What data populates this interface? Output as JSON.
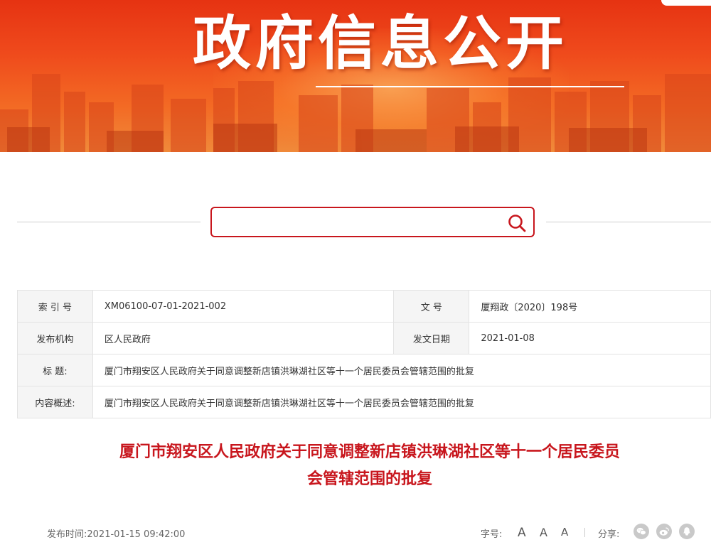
{
  "banner": {
    "title": "政府信息公开"
  },
  "search": {
    "placeholder": "",
    "value": ""
  },
  "info": {
    "index_label": "索 引 号",
    "index_value": "XM06100-07-01-2021-002",
    "doc_no_label": "文 号",
    "doc_no_value": "厦翔政〔2020〕198号",
    "issuer_label": "发布机构",
    "issuer_value": "区人民政府",
    "issue_date_label": "发文日期",
    "issue_date_value": "2021-01-08",
    "title_label": "标 题:",
    "title_value": "厦门市翔安区人民政府关于同意调整新店镇洪琳湖社区等十一个居民委员会管辖范围的批复",
    "summary_label": "内容概述:",
    "summary_value": "厦门市翔安区人民政府关于同意调整新店镇洪琳湖社区等十一个居民委员会管辖范围的批复"
  },
  "article": {
    "title_line1": "厦门市翔安区人民政府关于同意调整新店镇洪琳湖社区等十一个居民委员",
    "title_line2": "会管辖范围的批复"
  },
  "meta": {
    "publish_time": "发布时间:2021-01-15 09:42:00",
    "font_size_label": "字号:",
    "font_large": "A",
    "font_medium": "A",
    "font_small": "A",
    "share_label": "分享:",
    "share_icons": [
      "wechat-icon",
      "weibo-icon",
      "qq-icon"
    ]
  },
  "colors": {
    "accent": "#c8161d",
    "banner": "#e63312",
    "label_bg": "#f5f5f5",
    "border": "#e3e3e3"
  }
}
